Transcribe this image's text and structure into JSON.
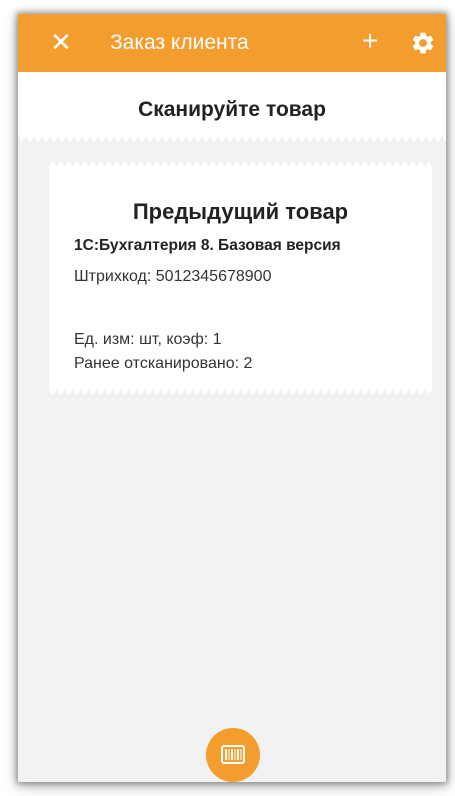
{
  "colors": {
    "accent": "#f49d2f",
    "background": "#f2f2f2",
    "card": "#ffffff"
  },
  "header": {
    "close_icon": "close-icon",
    "title": "Заказ клиента",
    "add_icon": "plus-icon",
    "settings_icon": "gear-icon"
  },
  "scan": {
    "prompt": "Сканируйте товар"
  },
  "previous_item": {
    "heading": "Предыдущий товар",
    "product_name": "1С:Бухгалтерия 8. Базовая версия",
    "barcode_line": "Штрихкод: 5012345678900",
    "unit_line": "Ед. изм: шт, коэф: 1",
    "scanned_line": "Ранее отсканировано: 2"
  },
  "footer": {
    "scan_button_icon": "barcode-icon"
  }
}
